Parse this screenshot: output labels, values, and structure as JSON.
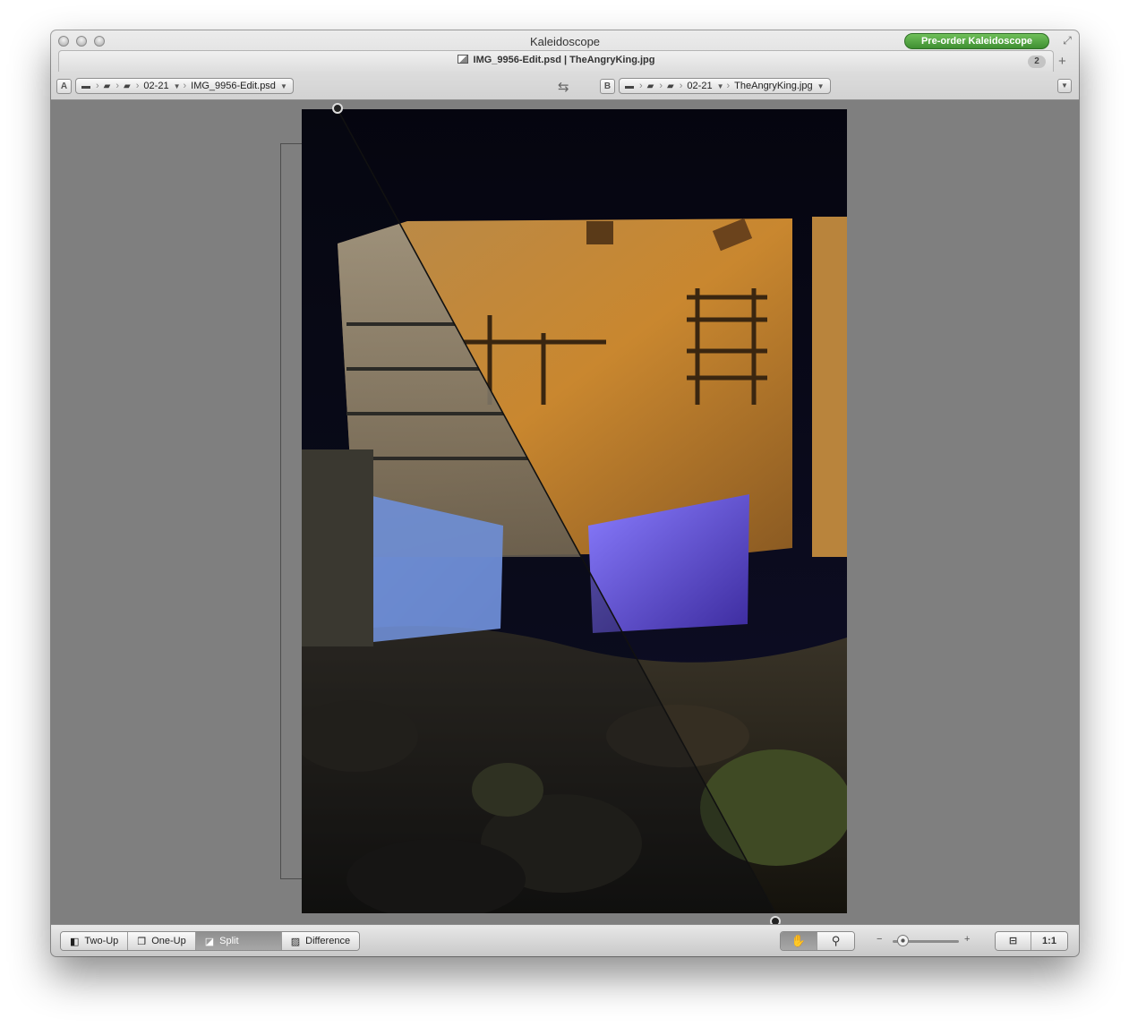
{
  "window": {
    "title": "Kaleidoscope",
    "preorder_label": "Pre-order Kaleidoscope"
  },
  "tab": {
    "label": "IMG_9956-Edit.psd | TheAngryKing.jpg",
    "count": "2"
  },
  "path_a": {
    "badge": "A",
    "folder": "02-21",
    "file": "IMG_9956-Edit.psd"
  },
  "path_b": {
    "badge": "B",
    "folder": "02-21",
    "file": "TheAngryKing.jpg"
  },
  "modes": [
    {
      "label": "Two-Up",
      "active": false
    },
    {
      "label": "One-Up",
      "active": false
    },
    {
      "label": "Split",
      "active": true
    },
    {
      "label": "Difference",
      "active": false
    }
  ],
  "tools": [
    {
      "icon": "hand-icon",
      "active": true
    },
    {
      "icon": "magnifier-icon",
      "active": false
    }
  ],
  "zoom": {
    "min_label": "−",
    "max_label": "+",
    "level": 0.15
  },
  "fit": {
    "actual_size_label": "1:1"
  },
  "colors": {
    "preorder_green": "#4caf3e",
    "canvas_gray": "#7f7f7f",
    "active_segment": "#9a9a9a"
  }
}
